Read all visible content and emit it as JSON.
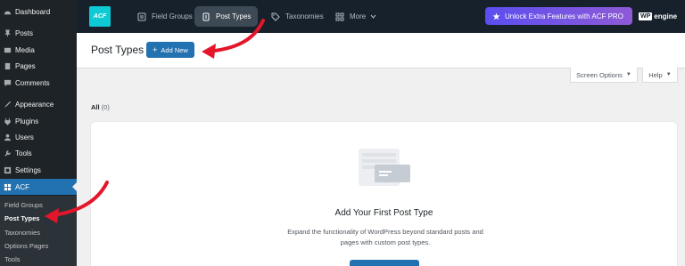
{
  "sidebar": {
    "items": [
      {
        "label": "Dashboard",
        "icon": "dashboard-icon"
      },
      {
        "label": "Posts",
        "icon": "pin-icon"
      },
      {
        "label": "Media",
        "icon": "media-icon"
      },
      {
        "label": "Pages",
        "icon": "pages-icon"
      },
      {
        "label": "Comments",
        "icon": "comment-icon"
      },
      {
        "label": "Appearance",
        "icon": "brush-icon"
      },
      {
        "label": "Plugins",
        "icon": "plugin-icon"
      },
      {
        "label": "Users",
        "icon": "users-icon"
      },
      {
        "label": "Tools",
        "icon": "wrench-icon"
      },
      {
        "label": "Settings",
        "icon": "settings-icon"
      },
      {
        "label": "ACF",
        "icon": "acf-grid-icon"
      }
    ],
    "submenu": [
      "Field Groups",
      "Post Types",
      "Taxonomies",
      "Options Pages",
      "Tools"
    ]
  },
  "topbar": {
    "logo": "ACF",
    "nav": [
      "Field Groups",
      "Post Types",
      "Taxonomies",
      "More"
    ],
    "unlock_label": "Unlock Extra Features with ACF PRO",
    "wpengine_mark": "WP",
    "wpengine_text": "engine"
  },
  "header": {
    "title": "Post Types",
    "add_new": "Add New"
  },
  "screen_options": "Screen Options",
  "help": "Help",
  "filter": {
    "label": "All",
    "count": "(0)"
  },
  "empty": {
    "title": "Add Your First Post Type",
    "description": "Expand the functionality of WordPress beyond standard posts and pages with custom post types."
  },
  "colors": {
    "accent": "#2271b1",
    "sidebar": "#1d2327",
    "topbar": "#16212b",
    "annotation": "#e3162a"
  }
}
